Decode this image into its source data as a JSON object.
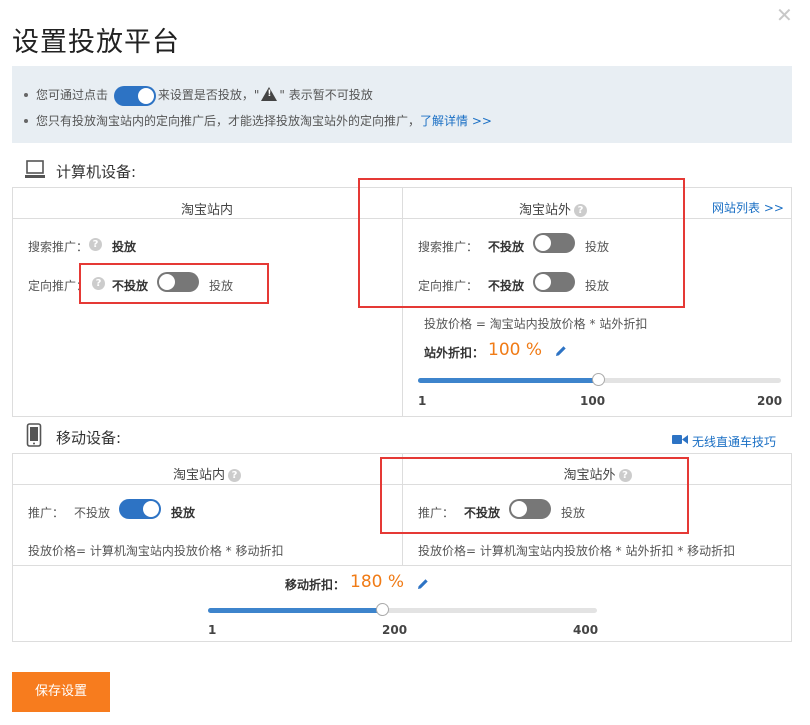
{
  "title": "设置投放平台",
  "notice": {
    "line1_prefix": "您可通过点击",
    "line1_middle": "来设置是否投放，\"",
    "line1_suffix": "\" 表示暂不可投放",
    "line2": "您只有投放淘宝站内的定向推广后，才能选择投放淘宝站外的定向推广，",
    "learn_more": "了解详情 >>"
  },
  "computer": {
    "title": "计算机设备:",
    "inside": {
      "heading": "淘宝站内",
      "search_label": "搜索推广：",
      "search_value": "投放",
      "targeted_label": "定向推广：",
      "targeted_off": "不投放",
      "targeted_on": "投放",
      "targeted_enabled": false
    },
    "outside": {
      "heading": "淘宝站外",
      "site_list_link": "网站列表 >>",
      "search_label": "搜索推广：",
      "search_off": "不投放",
      "search_on": "投放",
      "search_enabled": false,
      "targeted_label": "定向推广：",
      "targeted_off": "不投放",
      "targeted_on": "投放",
      "targeted_enabled": false,
      "price_formula": "投放价格 = 淘宝站内投放价格 * 站外折扣",
      "discount_label": "站外折扣：",
      "discount_value": "100 %",
      "discount_percent": 100,
      "slider_min": "1",
      "slider_mid": "100",
      "slider_max": "200"
    }
  },
  "mobile": {
    "title": "移动设备:",
    "tips_link": "无线直通车技巧",
    "inside": {
      "heading": "淘宝站内",
      "promo_label": "推广：",
      "promo_off": "不投放",
      "promo_on": "投放",
      "promo_enabled": true,
      "price_formula": "投放价格= 计算机淘宝站内投放价格 * 移动折扣"
    },
    "outside": {
      "heading": "淘宝站外",
      "promo_label": "推广：",
      "promo_off": "不投放",
      "promo_on": "投放",
      "promo_enabled": false,
      "price_formula": "投放价格= 计算机淘宝站内投放价格 * 站外折扣 * 移动折扣"
    },
    "discount_label": "移动折扣：",
    "discount_value": "180 %",
    "discount_percent": 180,
    "slider_min": "1",
    "slider_mid": "200",
    "slider_max": "400"
  },
  "save_label": "保存设置",
  "colors": {
    "accent_blue": "#2d73c4",
    "orange": "#f77c1e",
    "red_highlight": "#e53935"
  }
}
